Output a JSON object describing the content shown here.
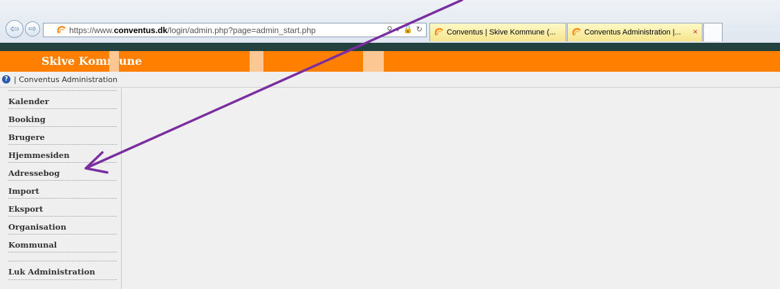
{
  "browser": {
    "url_prefix": "https://www.",
    "url_domain": "conventus.dk",
    "url_path": "/login/admin.php?page=admin_start.php",
    "addr_tools": "⚲ ▾ 🔒 ↻",
    "back_glyph": "⇦",
    "fwd_glyph": "⇨",
    "tabs": [
      {
        "label": "Conventus | Skive Kommune (..."
      },
      {
        "label": "Conventus Administration |...",
        "close": "×"
      }
    ]
  },
  "site": {
    "title": "Skive Kommune",
    "header_color": "#ff8000",
    "deco_color": "#fdc794"
  },
  "breadcrumb": {
    "help_glyph": "?",
    "text": "| Conventus Administration"
  },
  "sidebar": {
    "items": [
      {
        "label": "Kalender"
      },
      {
        "label": "Booking"
      },
      {
        "label": "Brugere"
      },
      {
        "label": "Hjemmesiden"
      },
      {
        "label": "Adressebog"
      },
      {
        "label": "Import"
      },
      {
        "label": "Eksport"
      },
      {
        "label": "Organisation"
      },
      {
        "label": "Kommunal"
      }
    ],
    "close_label": "Luk Administration"
  },
  "annotation": {
    "arrow_color": "#7a2ea0"
  }
}
